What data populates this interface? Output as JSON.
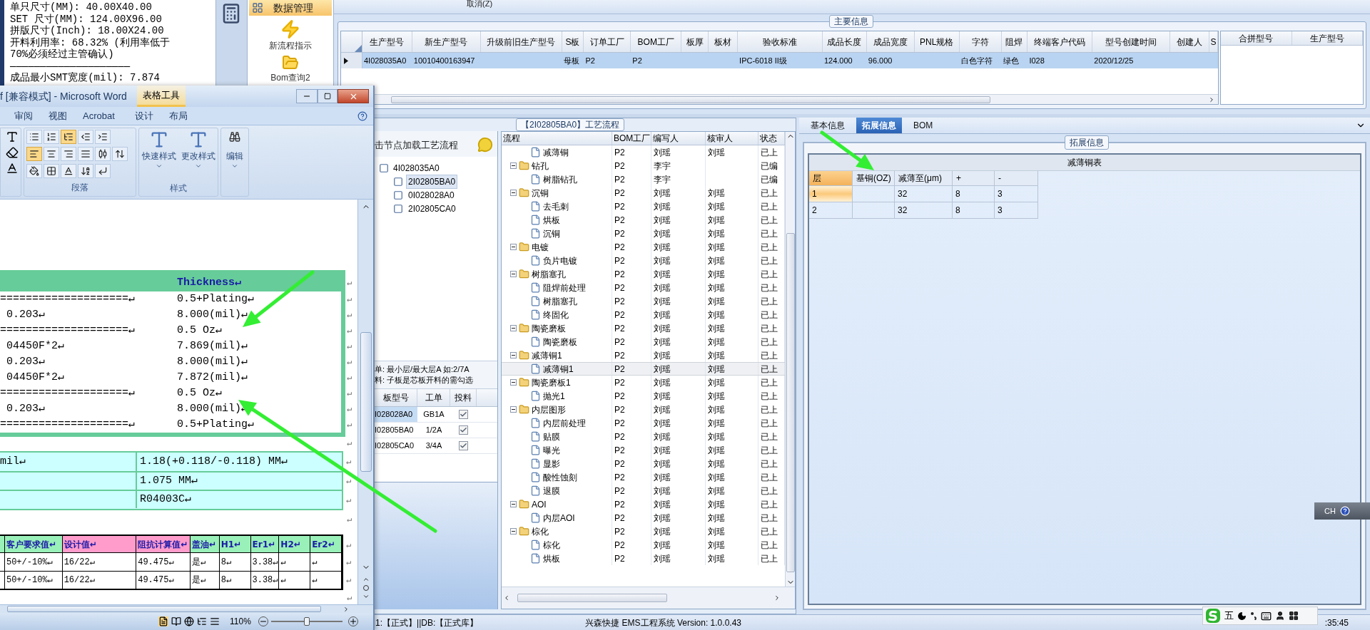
{
  "notepad": {
    "lines": [
      "单只尺寸(MM): 40.00X40.00",
      "SET 尺寸(MM): 124.00X96.00",
      "拼版尺寸(Inch): 18.00X24.00",
      "开料利用率: 68.32% (利用率低于",
      "70%必须经过主管确认)",
      "————————————————————",
      "成品最小SMT宽度(mil): 7.874"
    ]
  },
  "app_nav": {
    "header": "数据管理",
    "items": [
      {
        "label": "新流程指示",
        "kind": "lightning"
      },
      {
        "label": "Bom查询2",
        "kind": "folder"
      }
    ]
  },
  "toolbar": {
    "cancel": "取消(Z)"
  },
  "main_info": {
    "legend": "主要信息",
    "columns": [
      "生产型号",
      "新生产型号",
      "升级前旧生产型号",
      "S板",
      "订单工厂",
      "BOM工厂",
      "板厚",
      "板材",
      "验收标准",
      "成品长度",
      "成品宽度",
      "PNL规格",
      "字符",
      "阻焊",
      "终端客户代码",
      "型号创建时间",
      "创建人",
      "S"
    ],
    "rows": [
      {
        "selected": true,
        "cells": [
          "4I028035A0",
          "10010400163947",
          null,
          "母板",
          "P2",
          "P2",
          null,
          null,
          "IPC-6018 II级",
          "124.000",
          "96.000",
          null,
          "白色字符",
          "绿色",
          "I028",
          "2020/12/25",
          null,
          null
        ]
      }
    ],
    "side_columns": [
      "合拼型号",
      "生产型号"
    ]
  },
  "process": {
    "legend": "【2I02805BA0】工艺流程",
    "tree_title": "击节点加载工艺流程",
    "tree": [
      {
        "label": "4I028035A0",
        "selected": false,
        "children": [
          {
            "label": "2I02805BA0",
            "selected": true
          },
          {
            "label": "0I028028A0",
            "selected": false
          },
          {
            "label": "2I02805CA0",
            "selected": false
          }
        ]
      }
    ],
    "notes": [
      "单: 最小层/最大层A 如:2/7A",
      "料: 子板是芯板开料的需勾选"
    ],
    "sub_grid": {
      "columns": [
        "板型号",
        "工单",
        "投料"
      ],
      "rows": [
        {
          "board": "I028028A0",
          "order": "GB1A",
          "checked": true,
          "selected": true
        },
        {
          "board": "I02805BA0",
          "order": "1/2A",
          "checked": true,
          "selected": false
        },
        {
          "board": "I02805CA0",
          "order": "3/4A",
          "checked": true,
          "selected": false
        }
      ]
    },
    "flow": {
      "columns": [
        "流程",
        "BOM工厂",
        "编写人",
        "核审人",
        "状态"
      ],
      "rows": [
        {
          "children": [
            {
              "name": "减薄铜",
              "bom": "P2",
              "writer": "刘瑶",
              "reviewer": "刘瑶",
              "status": "已上",
              "selected": false
            }
          ]
        },
        {
          "name": "钻孔",
          "bom": "P2",
          "writer": "李宇",
          "status": "已编",
          "selected": false,
          "children": [
            {
              "name": "树脂钻孔",
              "bom": "P2",
              "writer": "李宇",
              "status": "已编",
              "selected": false
            }
          ]
        },
        {
          "name": "沉铜",
          "bom": "P2",
          "writer": "刘瑶",
          "reviewer": "刘瑶",
          "status": "已上",
          "selected": false,
          "children": [
            {
              "name": "去毛刺",
              "bom": "P2",
              "writer": "刘瑶",
              "reviewer": "刘瑶",
              "status": "已上",
              "selected": false
            },
            {
              "name": "烘板",
              "bom": "P2",
              "writer": "刘瑶",
              "reviewer": "刘瑶",
              "status": "已上",
              "selected": false
            },
            {
              "name": "沉铜",
              "bom": "P2",
              "writer": "刘瑶",
              "reviewer": "刘瑶",
              "status": "已上",
              "selected": false
            }
          ]
        },
        {
          "name": "电镀",
          "bom": "P2",
          "writer": "刘瑶",
          "reviewer": "刘瑶",
          "status": "已上",
          "selected": false,
          "children": [
            {
              "name": "负片电镀",
              "bom": "P2",
              "writer": "刘瑶",
              "reviewer": "刘瑶",
              "status": "已上",
              "selected": false
            }
          ]
        },
        {
          "name": "树脂塞孔",
          "bom": "P2",
          "writer": "刘瑶",
          "reviewer": "刘瑶",
          "status": "已上",
          "selected": false,
          "children": [
            {
              "name": "阻焊前处理",
              "bom": "P2",
              "writer": "刘瑶",
              "reviewer": "刘瑶",
              "status": "已上",
              "selected": false
            },
            {
              "name": "树脂塞孔",
              "bom": "P2",
              "writer": "刘瑶",
              "reviewer": "刘瑶",
              "status": "已上",
              "selected": false
            },
            {
              "name": "终固化",
              "bom": "P2",
              "writer": "刘瑶",
              "reviewer": "刘瑶",
              "status": "已上",
              "selected": false
            }
          ]
        },
        {
          "name": "陶瓷磨板",
          "bom": "P2",
          "writer": "刘瑶",
          "reviewer": "刘瑶",
          "status": "已上",
          "selected": false,
          "children": [
            {
              "name": "陶瓷磨板",
              "bom": "P2",
              "writer": "刘瑶",
              "reviewer": "刘瑶",
              "status": "已上",
              "selected": false
            }
          ]
        },
        {
          "name": "减薄铜1",
          "bom": "P2",
          "writer": "刘瑶",
          "reviewer": "刘瑶",
          "status": "已上",
          "selected": false,
          "children": [
            {
              "name": "减薄铜1",
              "bom": "P2",
              "writer": "刘瑶",
              "reviewer": "刘瑶",
              "status": "已上",
              "selected": true
            }
          ]
        },
        {
          "name": "陶瓷磨板1",
          "bom": "P2",
          "writer": "刘瑶",
          "reviewer": "刘瑶",
          "status": "已上",
          "selected": false,
          "children": [
            {
              "name": "抛光1",
              "bom": "P2",
              "writer": "刘瑶",
              "reviewer": "刘瑶",
              "status": "已上",
              "selected": false
            }
          ]
        },
        {
          "name": "内层图形",
          "bom": "P2",
          "writer": "刘瑶",
          "reviewer": "刘瑶",
          "status": "已上",
          "selected": false,
          "children": [
            {
              "name": "内层前处理",
              "bom": "P2",
              "writer": "刘瑶",
              "reviewer": "刘瑶",
              "status": "已上",
              "selected": false
            },
            {
              "name": "贴膜",
              "bom": "P2",
              "writer": "刘瑶",
              "reviewer": "刘瑶",
              "status": "已上",
              "selected": false
            },
            {
              "name": "曝光",
              "bom": "P2",
              "writer": "刘瑶",
              "reviewer": "刘瑶",
              "status": "已上",
              "selected": false
            },
            {
              "name": "显影",
              "bom": "P2",
              "writer": "刘瑶",
              "reviewer": "刘瑶",
              "status": "已上",
              "selected": false
            },
            {
              "name": "酸性蚀刻",
              "bom": "P2",
              "writer": "刘瑶",
              "reviewer": "刘瑶",
              "status": "已上",
              "selected": false
            },
            {
              "name": "退膜",
              "bom": "P2",
              "writer": "刘瑶",
              "reviewer": "刘瑶",
              "status": "已上",
              "selected": false
            }
          ]
        },
        {
          "name": "AOI",
          "bom": "P2",
          "writer": "刘瑶",
          "reviewer": "刘瑶",
          "status": "已上",
          "selected": false,
          "children": [
            {
              "name": "内层AOI",
              "bom": "P2",
              "writer": "刘瑶",
              "reviewer": "刘瑶",
              "status": "已上",
              "selected": false
            }
          ]
        },
        {
          "name": "棕化",
          "bom": "P2",
          "writer": "刘瑶",
          "reviewer": "刘瑶",
          "status": "已上",
          "selected": false,
          "children": [
            {
              "name": "棕化",
              "bom": "P2",
              "writer": "刘瑶",
              "reviewer": "刘瑶",
              "status": "已上",
              "selected": false
            },
            {
              "name": "烘板",
              "bom": "P2",
              "writer": "刘瑶",
              "reviewer": "刘瑶",
              "status": "已上",
              "selected": false
            }
          ]
        }
      ]
    }
  },
  "detail": {
    "tabs": [
      {
        "label": "基本信息",
        "selected": false
      },
      {
        "label": "拓展信息",
        "selected": true
      },
      {
        "label": "BOM",
        "selected": false
      }
    ],
    "legend": "拓展信息",
    "table_title": "减薄铜表",
    "columns": [
      "层",
      "基铜(OZ)",
      "减薄至(μm)",
      "+",
      "-"
    ],
    "rows": [
      {
        "selected": true,
        "cells": [
          "1",
          null,
          "32",
          "8",
          "3"
        ]
      },
      {
        "selected": false,
        "cells": [
          "2",
          null,
          "32",
          "8",
          "3"
        ]
      }
    ]
  },
  "status": {
    "left": "1:【正式】||DB:【正式库】",
    "version": "兴森快捷 EMS工程系统 Version: 1.0.0.43",
    "time": ":35:45"
  },
  "language_bar": {
    "label": "CH"
  },
  "ime": {
    "mode": "五"
  },
  "word": {
    "title": "f [兼容模式] - Microsoft Word",
    "context_tab": "表格工具",
    "tabs": [
      "审阅",
      "视图",
      "Acrobat",
      "设计",
      "布局"
    ],
    "paragraph_buttons": [
      [
        {
          "kind": "bullets",
          "selected": false
        },
        {
          "kind": "numbering",
          "selected": false
        },
        {
          "kind": "multilevel",
          "selected": true
        },
        {
          "kind": "outdent",
          "selected": false
        },
        {
          "kind": "indent",
          "selected": false
        }
      ],
      [
        {
          "kind": "align-left",
          "selected": true
        },
        {
          "kind": "align-center",
          "selected": false
        },
        {
          "kind": "align-right",
          "selected": false
        },
        {
          "kind": "justify",
          "selected": false
        },
        {
          "kind": "distribute",
          "selected": false
        },
        {
          "kind": "line-spacing",
          "selected": false
        }
      ],
      [
        {
          "kind": "shading",
          "selected": false
        },
        {
          "kind": "borders",
          "selected": false
        },
        {
          "kind": "asian-layout",
          "selected": false
        },
        {
          "kind": "sort",
          "selected": false
        },
        {
          "kind": "show-marks",
          "selected": false
        }
      ]
    ],
    "paragraph_group": "段落",
    "styles": [
      "快速样式",
      "更改样式"
    ],
    "styles_group": "样式",
    "editing": "编辑",
    "thickness": {
      "header": "Thickness↵",
      "end": "↵",
      "rows": [
        {
          "left": "====================↵",
          "right": "0.5+Plating↵",
          "end": "↵"
        },
        {
          "left": "0.203↵",
          "right": "8.000(mil)↵",
          "end": "↵"
        },
        {
          "left": "====================↵",
          "right": "0.5 Oz↵",
          "end": "↵"
        },
        {
          "left": "04450F*2↵",
          "right": "7.869(mil)↵",
          "end": "↵"
        },
        {
          "left": "0.203↵",
          "right": "8.000(mil)↵",
          "end": "↵"
        },
        {
          "left": "04450F*2↵",
          "right": "7.872(mil)↵",
          "end": "↵"
        },
        {
          "left": "====================↵",
          "right": "0.5 Oz↵",
          "end": "↵"
        },
        {
          "left": "0.203↵",
          "right": "8.000(mil)↵",
          "end": "↵"
        },
        {
          "left": "====================↵",
          "right": "0.5+Plating↵",
          "end": "↵"
        }
      ]
    },
    "marks": [
      "↵",
      "↵",
      "↵"
    ],
    "spec": [
      {
        "left": "mil↵",
        "right": "1.18(+0.118/-0.118) MM↵",
        "end": "↵"
      },
      {
        "right": "1.075 MM↵",
        "end": "↵"
      },
      {
        "right": "R04003C↵",
        "end": "↵"
      }
    ],
    "impedance": {
      "columns": [
        {
          "label": "客户要求值↵",
          "color": "#99f0b8"
        },
        {
          "label": "设计值↵",
          "color": "#ff9ccc"
        },
        {
          "label": "阻抗计算值↵",
          "color": "#ff9ccc"
        },
        {
          "label": "盖油↵",
          "color": "#99f0b8"
        },
        {
          "label": "H1↵",
          "color": "#99f0b8"
        },
        {
          "label": "Er1↵",
          "color": "#99f0b8"
        },
        {
          "label": "H2↵",
          "color": "#99f0b8"
        },
        {
          "label": "Er2↵",
          "color": "#99f0b8"
        }
      ],
      "end": "↵",
      "rows": [
        {
          "cells": [
            "50+/-10%↵",
            "16/22↵",
            "49.475↵",
            "是↵",
            "8↵",
            "3.38↵",
            "↵",
            "↵"
          ],
          "end": "↵"
        },
        {
          "cells": [
            "50+/-10%↵",
            "16/22↵",
            "49.475↵",
            "是↵",
            "8↵",
            "3.38↵",
            "↵",
            "↵"
          ],
          "end": "↵"
        }
      ]
    },
    "zoom": "110%",
    "zoom_slider": {
      "level": 0.5
    }
  }
}
